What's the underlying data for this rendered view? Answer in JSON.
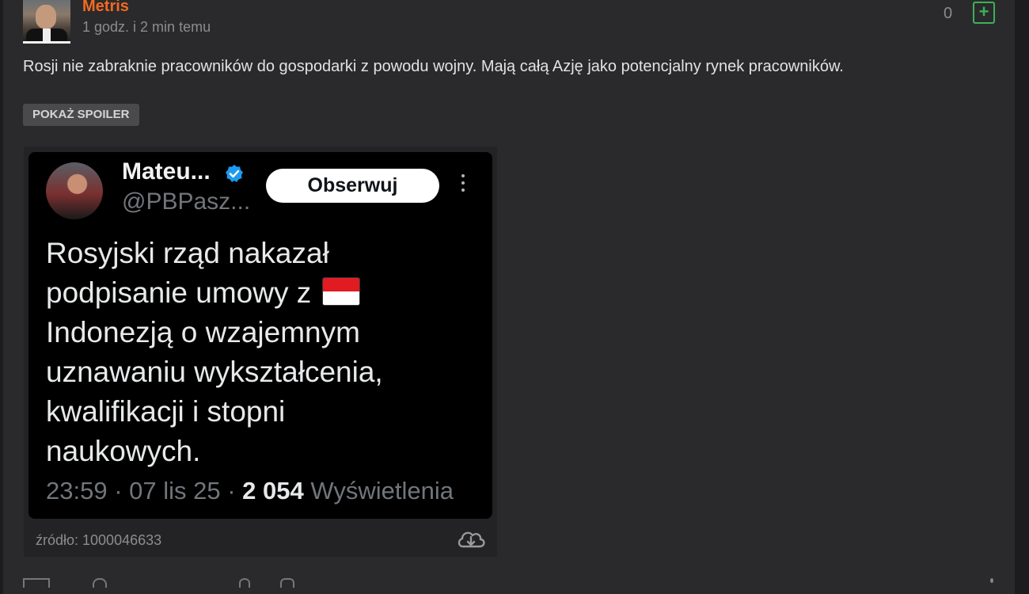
{
  "post": {
    "username": "Metris",
    "timestamp": "1 godz. i 2 min temu",
    "score": "0",
    "plus_label": "+",
    "text": "Rosji nie zabraknie pracowników do gospodarki z powodu wojny. Mają całą Azję jako potencjalny rynek pracowników.",
    "spoiler_label": "POKAŻ SPOILER",
    "source_label": "źródło: 1000046633"
  },
  "tweet": {
    "name": "Mateu...",
    "handle": "@PBPasz...",
    "follow_label": "Obserwuj",
    "body_line1": "Rosyjski rząd nakazał",
    "body_line2": "podpisanie umowy z",
    "body_line3": "Indonezją o wzajemnym",
    "body_line4": "uznawaniu wykształcenia,",
    "body_line5": "kwalifikacji i stopni",
    "body_line6": "naukowych.",
    "time": "23:59 · 07 lis 25 · ",
    "views_count": "2 054",
    "views_label": " Wyświetlenia",
    "verified_color": "#1d9bf0"
  },
  "colors": {
    "username": "#f26a21",
    "plus": "#3bb15a",
    "card_bg": "#2a2a2c"
  },
  "icons": [
    "plus-icon",
    "verified-badge-icon",
    "more-options-icon",
    "indonesia-flag-icon",
    "cloud-download-icon"
  ]
}
